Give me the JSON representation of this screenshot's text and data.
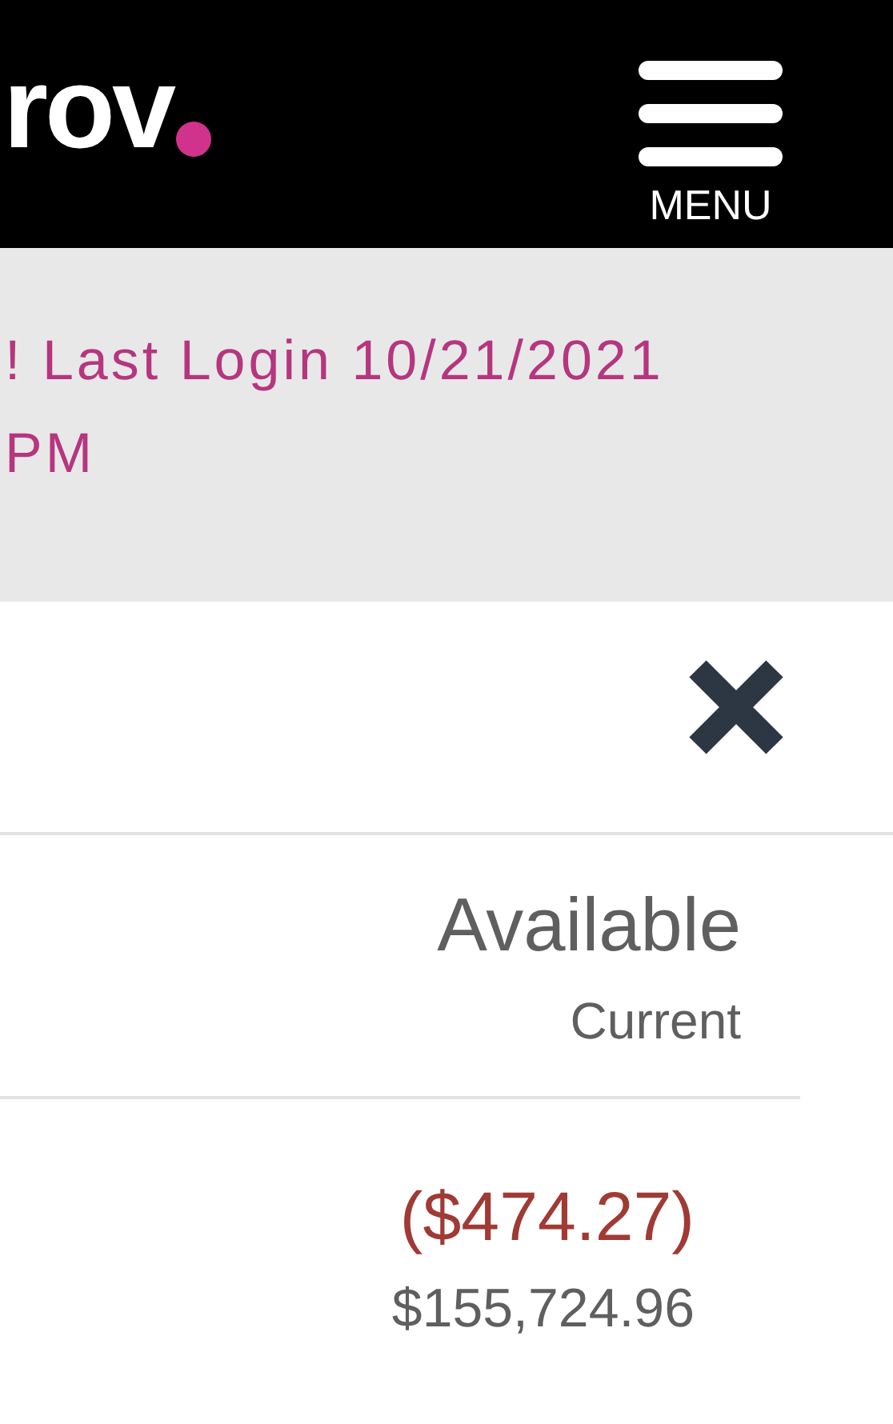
{
  "header": {
    "logo_text": "rov",
    "menu_label": "MENU"
  },
  "banner": {
    "lines": [
      "! Last Login 10/21/2021",
      "PM"
    ]
  },
  "table": {
    "column_heading": "Available",
    "column_subheading": "Current",
    "rows": [
      {
        "amount": "($474.27)",
        "negative": true,
        "balance": "$155,724.96"
      }
    ]
  }
}
